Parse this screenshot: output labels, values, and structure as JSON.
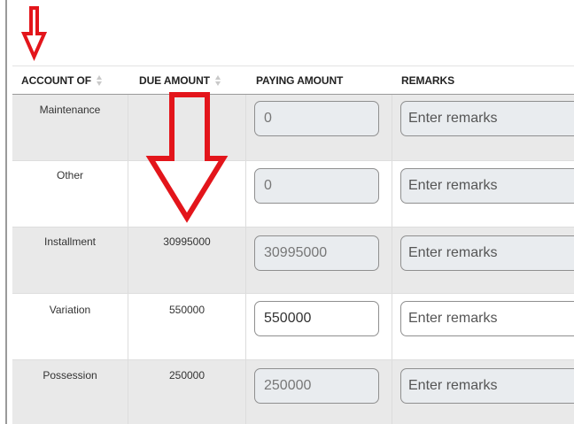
{
  "table": {
    "headers": {
      "account_of": "ACCOUNT OF",
      "due_amount": "DUE AMOUNT",
      "paying_amount": "PAYING AMOUNT",
      "remarks": "REMARKS"
    },
    "rows": [
      {
        "account_of": "Maintenance",
        "due_amount": "",
        "paying_amount": "0",
        "remarks_placeholder": "Enter remarks",
        "editable": false
      },
      {
        "account_of": "Other",
        "due_amount": "",
        "paying_amount": "0",
        "remarks_placeholder": "Enter remarks",
        "editable": false
      },
      {
        "account_of": "Installment",
        "due_amount": "30995000",
        "paying_amount": "30995000",
        "remarks_placeholder": "Enter remarks",
        "editable": false
      },
      {
        "account_of": "Variation",
        "due_amount": "550000",
        "paying_amount": "550000",
        "remarks_placeholder": "Enter remarks",
        "editable": true
      },
      {
        "account_of": "Possession",
        "due_amount": "250000",
        "paying_amount": "250000",
        "remarks_placeholder": "Enter remarks",
        "editable": false
      }
    ]
  },
  "annotations": {
    "arrow_color": "#e3151b",
    "row_grey": "#e9e9e9",
    "input_disabled_bg": "#e9ecef"
  }
}
